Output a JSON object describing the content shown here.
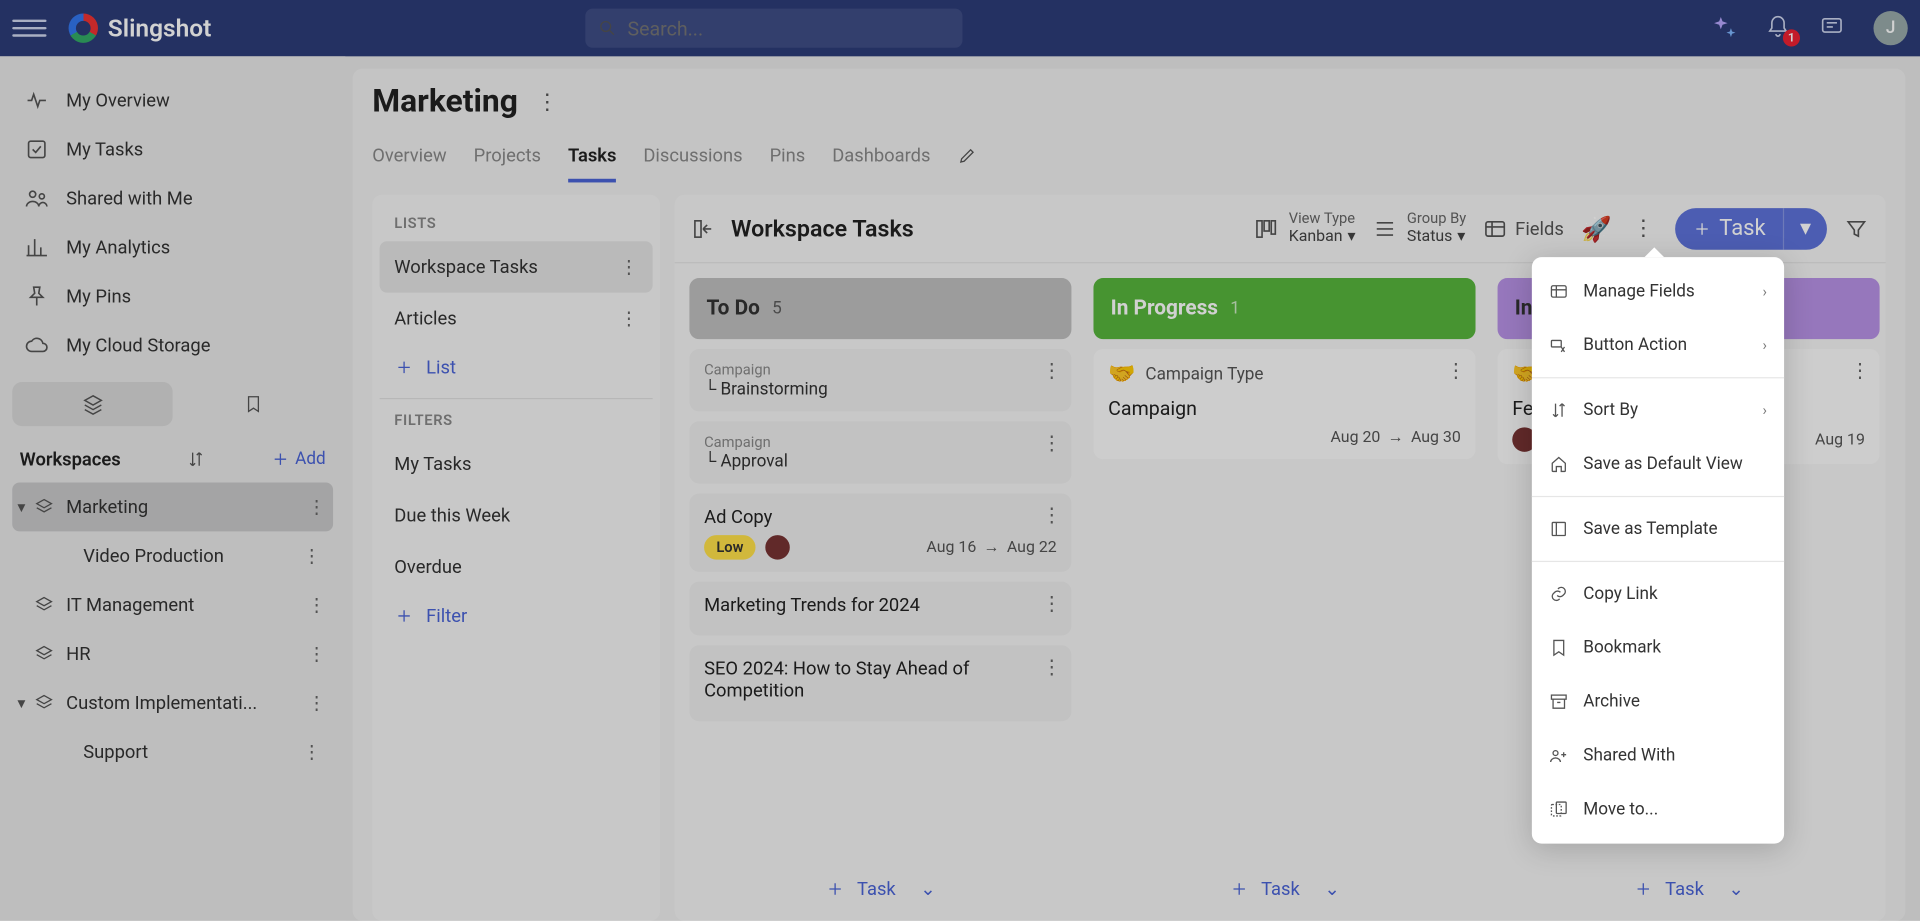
{
  "app_name": "Slingshot",
  "search_placeholder": "Search...",
  "notif_count": "1",
  "avatar_initial": "J",
  "sidebar": {
    "items": [
      {
        "label": "My Overview"
      },
      {
        "label": "My Tasks"
      },
      {
        "label": "Shared with Me"
      },
      {
        "label": "My Analytics"
      },
      {
        "label": "My Pins"
      },
      {
        "label": "My Cloud Storage"
      }
    ],
    "workspaces_label": "Workspaces",
    "add_label": "Add",
    "workspaces": [
      {
        "label": "Marketing",
        "expanded": true,
        "active": true,
        "children": [
          {
            "label": "Video Production"
          }
        ]
      },
      {
        "label": "IT Management"
      },
      {
        "label": "HR"
      },
      {
        "label": "Custom Implementati...",
        "expanded": true,
        "children": [
          {
            "label": "Support"
          }
        ]
      }
    ]
  },
  "page_title": "Marketing",
  "tabs": [
    "Overview",
    "Projects",
    "Tasks",
    "Discussions",
    "Pins",
    "Dashboards"
  ],
  "active_tab": "Tasks",
  "lists": {
    "lists_label": "LISTS",
    "items": [
      {
        "label": "Workspace Tasks",
        "active": true
      },
      {
        "label": "Articles"
      }
    ],
    "add_list": "List",
    "filters_label": "FILTERS",
    "filters": [
      {
        "label": "My Tasks"
      },
      {
        "label": "Due this Week"
      },
      {
        "label": "Overdue"
      }
    ],
    "add_filter": "Filter"
  },
  "board": {
    "title": "Workspace Tasks",
    "view_type_label": "View Type",
    "view_type_value": "Kanban",
    "group_by_label": "Group By",
    "group_by_value": "Status",
    "fields_label": "Fields",
    "task_button": "Task",
    "add_task_label": "Task",
    "columns": [
      {
        "name": "To Do",
        "count": "5",
        "color": "#bfbfbf",
        "text": "#333",
        "cards": [
          {
            "sup": "Campaign",
            "crumb": "Brainstorming"
          },
          {
            "sup": "Campaign",
            "crumb": "Approval"
          },
          {
            "title": "Ad Copy",
            "low": "Low",
            "date1": "Aug 16",
            "date2": "Aug 22"
          },
          {
            "title": "Marketing Trends for 2024"
          },
          {
            "title": "SEO 2024: How to Stay Ahead of Competition"
          }
        ]
      },
      {
        "name": "In Progress",
        "count": "1",
        "color": "#57b53c",
        "text": "#fff",
        "cards": [
          {
            "white": true,
            "handshake": true,
            "title_sub": "Campaign Type",
            "main": "Campaign",
            "date1": "Aug 20",
            "date2": "Aug 30"
          }
        ]
      },
      {
        "name": "In Review",
        "count": "",
        "color": "#b892e6",
        "text": "#333",
        "cards": [
          {
            "white": true,
            "handshake": true,
            "title_sub": "",
            "main": "Fee",
            "date2": "Aug 19",
            "peek": true
          }
        ]
      }
    ]
  },
  "context_menu": [
    {
      "label": "Manage Fields",
      "arrow": true,
      "icon": "fields"
    },
    {
      "label": "Button Action",
      "arrow": true,
      "icon": "cursor"
    },
    {
      "sep": true
    },
    {
      "label": "Sort By",
      "arrow": true,
      "icon": "sort"
    },
    {
      "label": "Save as Default View",
      "icon": "home"
    },
    {
      "sep": true
    },
    {
      "label": "Save as Template",
      "icon": "template"
    },
    {
      "sep": true
    },
    {
      "label": "Copy Link",
      "icon": "link"
    },
    {
      "label": "Bookmark",
      "icon": "bookmark"
    },
    {
      "label": "Archive",
      "icon": "archive"
    },
    {
      "label": "Shared With",
      "icon": "share"
    },
    {
      "label": "Move to...",
      "icon": "move"
    }
  ]
}
